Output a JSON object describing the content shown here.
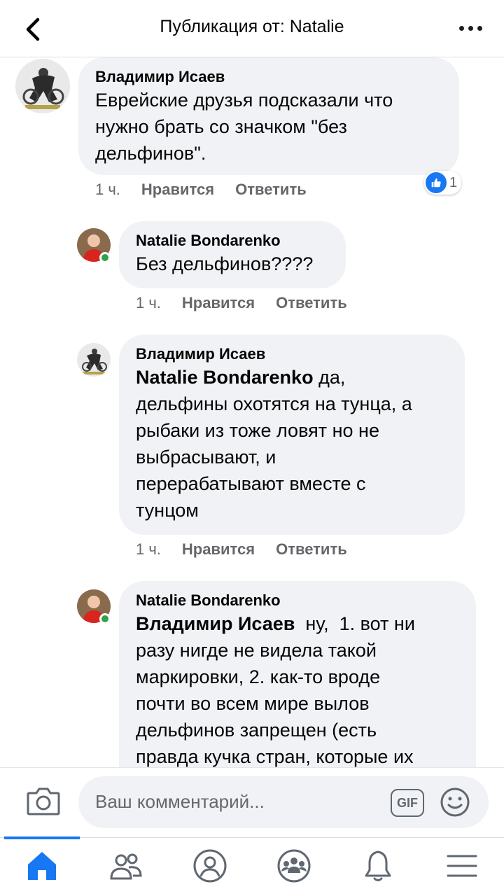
{
  "header": {
    "title": "Публикация от: Natalie"
  },
  "comments": [
    {
      "author": "Владимир Исаев",
      "lines": [
        "Еврейские друзья подсказали что",
        "нужно брать со значком \"без",
        "дельфинов\"."
      ],
      "time": "1 ч.",
      "like_label": "Нравится",
      "reply_label": "Ответить",
      "reaction_count": "1"
    },
    {
      "author": "Natalie Bondarenko",
      "lines": [
        "Без дельфинов????"
      ],
      "time": "1 ч.",
      "like_label": "Нравится",
      "reply_label": "Ответить"
    },
    {
      "author": "Владимир Исаев",
      "mention": "Natalie Bondarenko",
      "first_line_rest": " да,",
      "lines": [
        "дельфины охотятся на тунца, а",
        "рыбаки из тоже ловят но не",
        "выбрасывают, и",
        "перерабатывают вместе с",
        "тунцом"
      ],
      "time": "1 ч.",
      "like_label": "Нравится",
      "reply_label": "Ответить"
    },
    {
      "author": "Natalie Bondarenko",
      "mention": "Владимир Исаев",
      "first_line_rest": "  ну,  1. вот ни",
      "lines": [
        "разу нигде не видела такой",
        "маркировки, 2. как-то вроде",
        "почти во всем мире вылов",
        "дельфинов запрещен (есть",
        "правда кучка стран, которые их"
      ]
    }
  ],
  "composer": {
    "placeholder": "Ваш комментарий...",
    "gif_label": "GIF"
  },
  "colors": {
    "accent": "#1877f2",
    "bubble": "#f0f2f5",
    "meta": "#65676b",
    "online": "#31a24c"
  }
}
